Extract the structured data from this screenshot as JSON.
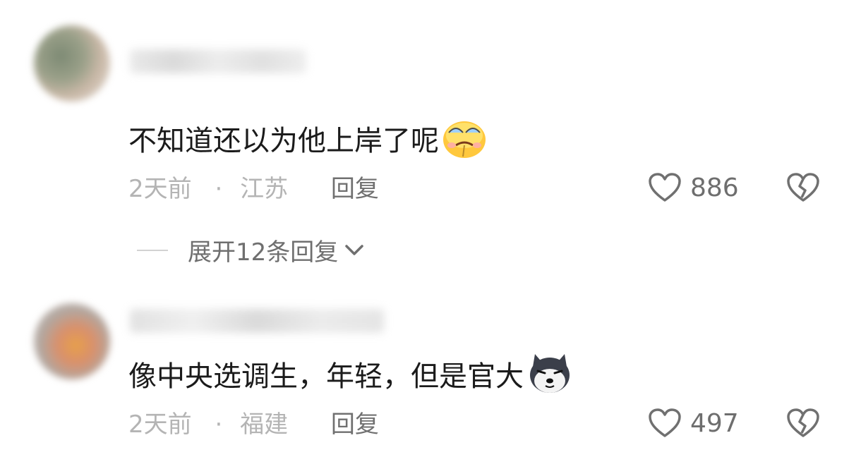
{
  "comments": [
    {
      "text": "不知道还以为他上岸了呢",
      "emoji": "crying-face-emoji",
      "time": "2天前",
      "separator": "·",
      "location": "江苏",
      "reply_label": "回复",
      "likes": "886",
      "expand_label": "展开12条回复"
    },
    {
      "text": "像中央选调生，年轻，但是官大",
      "emoji": "husky-dog-emoji",
      "time": "2天前",
      "separator": "·",
      "location": "福建",
      "reply_label": "回复",
      "likes": "497"
    }
  ],
  "colors": {
    "text": "#1b1b1b",
    "meta": "#b4b4b4",
    "action": "#6e6e6e"
  }
}
